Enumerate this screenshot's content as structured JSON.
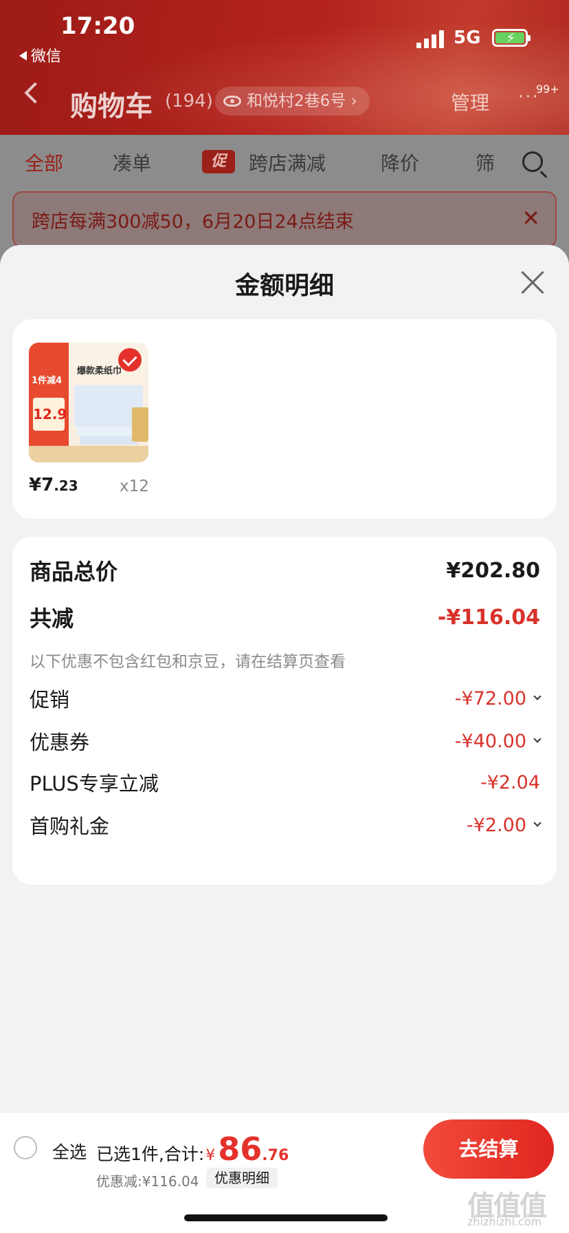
{
  "status_bar": {
    "time": "17:20",
    "back_app": "微信",
    "network": "5G",
    "battery_icon": "battery-charging-icon"
  },
  "header": {
    "title": "购物车",
    "count": "(194)",
    "address": "和悦村2巷6号 ›",
    "manage": "管理",
    "more": "···",
    "badge": "99+"
  },
  "tabs": {
    "items": [
      {
        "label": "全部",
        "active": true
      },
      {
        "label": "凑单",
        "active": false
      },
      {
        "label": "跨店满减",
        "active": false,
        "tag": "促"
      },
      {
        "label": "降价",
        "active": false
      },
      {
        "label": "筛",
        "active": false
      }
    ]
  },
  "banner": {
    "text": "跨店每满300减50，6月20日24点结束",
    "close": "✕"
  },
  "sheet": {
    "title": "金额明细",
    "product": {
      "thumb_headline": "爆款柔纸巾",
      "thumb_tag": "1件减4",
      "thumb_price": "12.9",
      "price_main": "¥7",
      "price_decimal": ".23",
      "quantity": "x12"
    },
    "detail": {
      "total_label": "商品总价",
      "total_value": "¥202.80",
      "reduce_label": "共减",
      "reduce_value": "-¥116.04",
      "note": "以下优惠不包含红包和京豆，请在结算页查看",
      "lines": [
        {
          "label": "促销",
          "value": "-¥72.00",
          "expandable": true
        },
        {
          "label": "优惠券",
          "value": "-¥40.00",
          "expandable": true
        },
        {
          "label": "PLUS专享立减",
          "value": "-¥2.04",
          "expandable": false
        },
        {
          "label": "首购礼金",
          "value": "-¥2.00",
          "expandable": true
        }
      ]
    }
  },
  "bottom_bar": {
    "select_all": "全选",
    "summary_prefix": "已选1件,合计:",
    "currency": "¥",
    "amount_int": "86",
    "amount_dec": ".76",
    "saved": "优惠减:¥116.04",
    "detail_link": "优惠明细",
    "checkout": "去结算"
  },
  "watermark": {
    "mark": "值值值",
    "url": "zhizhizhi.com"
  },
  "colors": {
    "accent_red": "#e4312b",
    "header_red": "#b4231d"
  }
}
